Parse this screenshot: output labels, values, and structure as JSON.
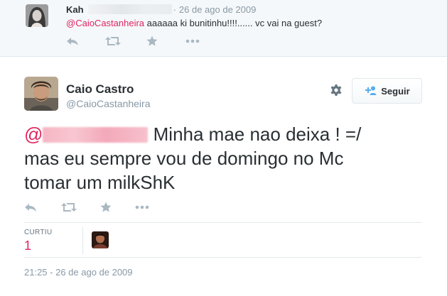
{
  "reply": {
    "name": "Kah",
    "separator": "·",
    "time": "26 de ago de 2009",
    "mention": "@CaioCastanheira",
    "text": " aaaaaa ki bunitinhu!!!!...... vc vai na guest?"
  },
  "tweet": {
    "name": "Caio Castro",
    "handle": "@CaioCastanheira",
    "follow_label": "Seguir",
    "mention_prefix": "@",
    "text_line1_rest": " Minha mae nao deixa ! =/",
    "text_line2": "mas eu sempre vou de domingo no Mc",
    "text_line3": "tomar um milkShK",
    "stats": {
      "likes_label": "CURTIU",
      "likes_count": "1"
    },
    "timestamp": "21:25 - 26 de ago de 2009"
  },
  "icons": {
    "reply": "reply-icon",
    "retweet": "retweet-icon",
    "favorite": "star-icon",
    "more": "more-icon",
    "settings": "gear-icon",
    "follow": "add-person-icon"
  },
  "colors": {
    "mention": "#e0245e",
    "text": "#292f33",
    "muted": "#8899a6",
    "action_icons": "#aab8c2"
  }
}
